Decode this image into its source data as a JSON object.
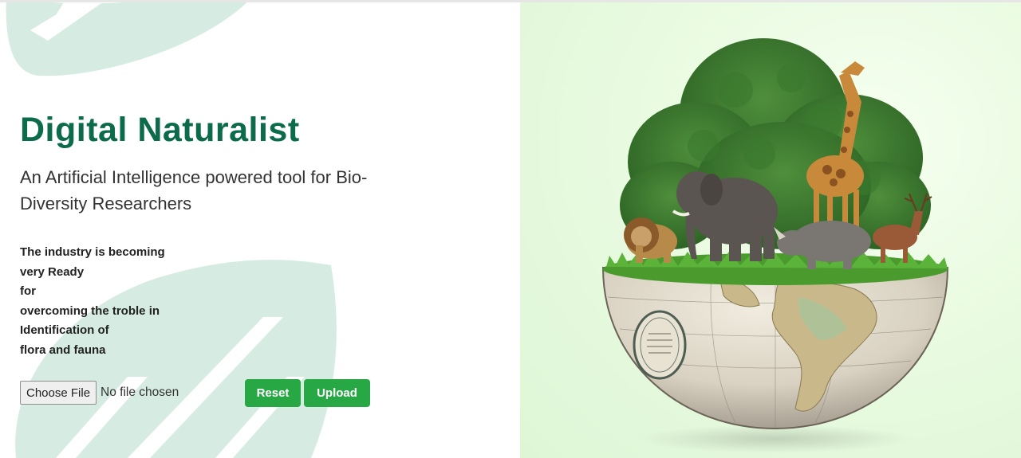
{
  "hero": {
    "title": "Digital Naturalist",
    "subtitle": "An Artificial Intelligence powered tool for Bio-Diversity Researchers",
    "description_lines": [
      "The industry is becoming",
      "very Ready",
      "for",
      "overcoming the troble in",
      "Identification of",
      "flora and fauna"
    ]
  },
  "upload_form": {
    "choose_file_label": "Choose File",
    "file_status": "No file chosen",
    "reset_label": "Reset",
    "upload_label": "Upload"
  },
  "colors": {
    "title": "#0b6b4a",
    "button": "#28a745",
    "leaf_decoration": "#d4ebe1",
    "image_background": "#e3f8da"
  },
  "image": {
    "subject": "half-globe-with-forest-and-wild-animals"
  }
}
